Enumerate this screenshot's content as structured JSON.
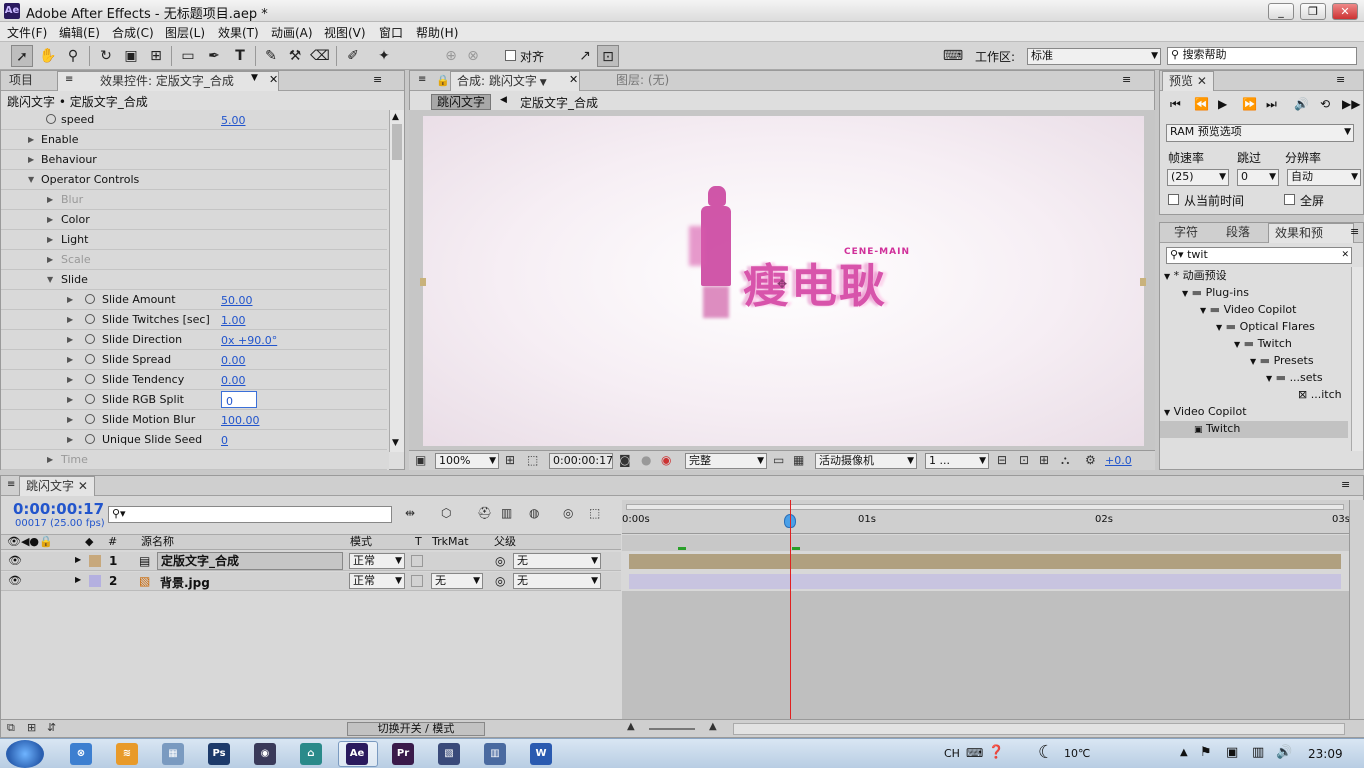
{
  "app": {
    "title": "Adobe After Effects - 无标题项目.aep *",
    "logo": "Ae"
  },
  "window_buttons": [
    "_",
    "❐",
    "✕"
  ],
  "menu": [
    "文件(F)",
    "编辑(E)",
    "合成(C)",
    "图层(L)",
    "效果(T)",
    "动画(A)",
    "视图(V)",
    "窗口",
    "帮助(H)"
  ],
  "toolbar": {
    "align_label": "对齐",
    "workspace_label": "工作区:",
    "workspace_value": "标准",
    "search_placeholder": "搜索帮助"
  },
  "left_panel": {
    "tabs": [
      "项目",
      "效果控件: 定版文字_合成"
    ],
    "breadcrumb": "跳闪文字 • 定版文字_合成",
    "rows": [
      {
        "label": "speed",
        "value": "5.00"
      },
      {
        "label": "Enable",
        "value": ""
      },
      {
        "label": "Behaviour",
        "value": ""
      },
      {
        "label": "Operator Controls",
        "value": ""
      },
      {
        "label": "Blur",
        "value": ""
      },
      {
        "label": "Color",
        "value": ""
      },
      {
        "label": "Light",
        "value": ""
      },
      {
        "label": "Scale",
        "value": ""
      },
      {
        "label": "Slide",
        "value": ""
      },
      {
        "label": "Slide Amount",
        "value": "50.00"
      },
      {
        "label": "Slide Twitches [sec]",
        "value": "1.00"
      },
      {
        "label": "Slide Direction",
        "value": "0x +90.0°"
      },
      {
        "label": "Slide Spread",
        "value": "0.00"
      },
      {
        "label": "Slide Tendency",
        "value": "0.00"
      },
      {
        "label": "Slide RGB Split",
        "value": "0"
      },
      {
        "label": "Slide Motion Blur",
        "value": "100.00"
      },
      {
        "label": "Unique Slide Seed",
        "value": "0"
      },
      {
        "label": "Time",
        "value": ""
      }
    ]
  },
  "comp_panel": {
    "tabs": [
      "合成: 跳闪文字",
      "图层: (无)"
    ],
    "breadcrumb_active": "跳闪文字",
    "breadcrumb_next": "定版文字_合成",
    "logo_small": "CENE-MAIN",
    "logo_text": "瘦电耿",
    "zoom": "100%",
    "timecode": "0:00:00:17",
    "quality": "完整",
    "camera": "活动摄像机",
    "views": "1 ...",
    "exposure": "+0.0"
  },
  "preview_panel": {
    "tab": "预览",
    "ram_label": "RAM 预览选项",
    "fps_label": "帧速率",
    "skip_label": "跳过",
    "res_label": "分辨率",
    "fps_value": "(25)",
    "skip_value": "0",
    "res_value": "自动",
    "from_current": "从当前时间",
    "fullscreen": "全屏"
  },
  "effects_panel": {
    "tabs": [
      "字符",
      "段落",
      "效果和预"
    ],
    "search_value": "twit",
    "tree": [
      "* 动画预设",
      "Plug-ins",
      "Video Copilot",
      "Optical Flares",
      "Twitch",
      "Presets",
      "...sets",
      "...itch",
      "Video Copilot",
      "Twitch"
    ]
  },
  "timeline": {
    "tab": "跳闪文字",
    "timecode": "0:00:00:17",
    "frame_info": "00017 (25.00 fps)",
    "col_source": "源名称",
    "col_mode": "模式",
    "col_t": "T",
    "col_trkmat": "TrkMat",
    "col_parent": "父级",
    "ruler": [
      "0:00s",
      "01s",
      "02s",
      "03s"
    ],
    "switch_label": "切换开关 / 模式",
    "layers": [
      {
        "num": "1",
        "name": "定版文字_合成",
        "mode": "正常",
        "trkmat": "",
        "parent": "无"
      },
      {
        "num": "2",
        "name": "背景.jpg",
        "mode": "正常",
        "trkmat": "无",
        "parent": "无"
      }
    ]
  },
  "taskbar": {
    "lang": "CH",
    "weather": "10℃",
    "time": "23:09",
    "apps": [
      "Ps",
      "Pr",
      "Ae",
      "W"
    ]
  },
  "colors": {
    "accent": "#2255cc",
    "playhead": "#e02020",
    "logo": "#d0309a"
  }
}
